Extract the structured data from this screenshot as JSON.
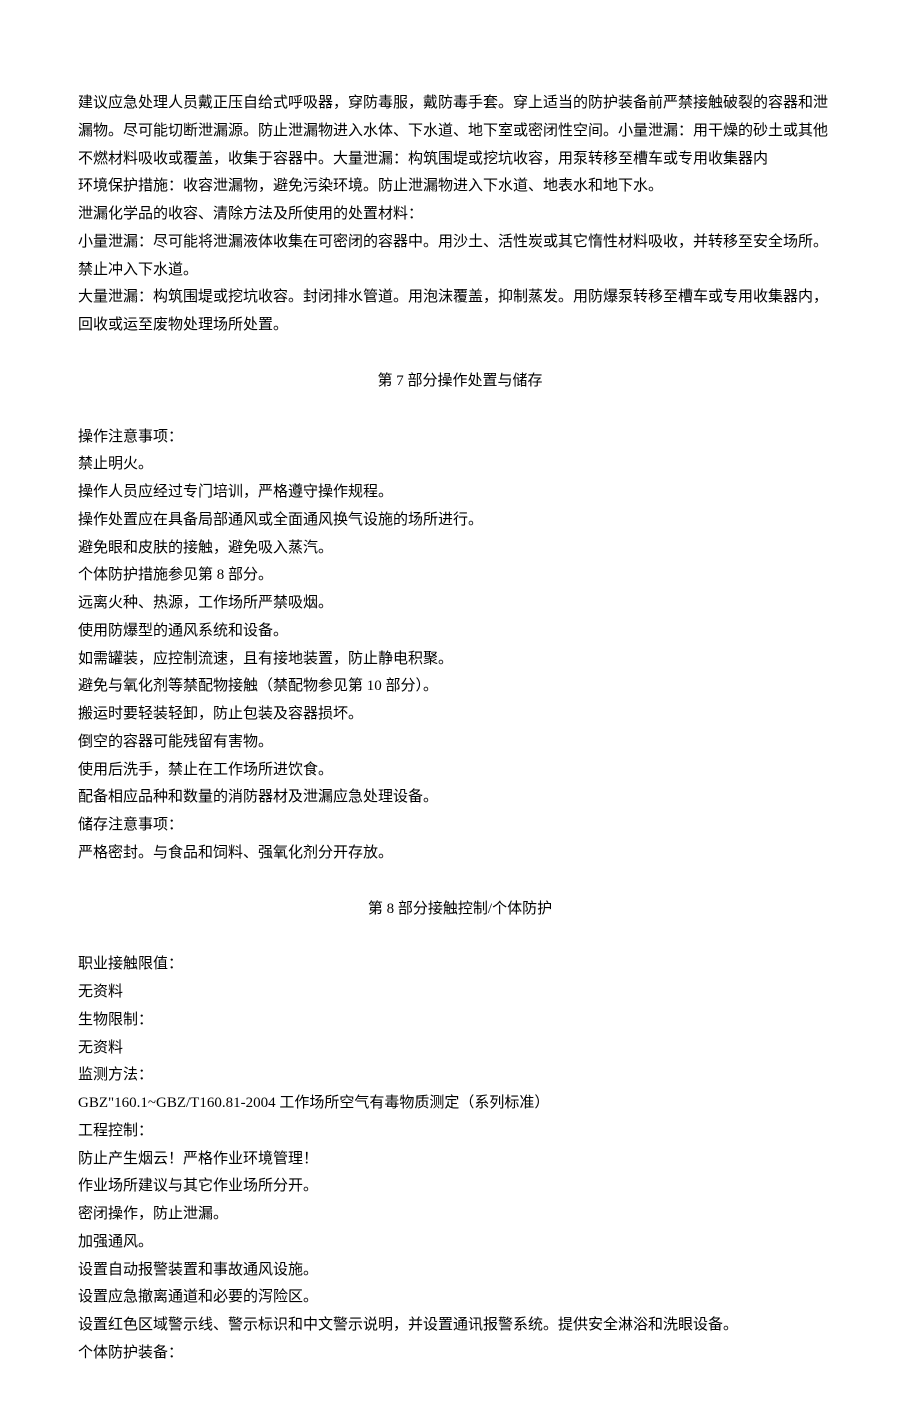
{
  "intro": {
    "p1": "建议应急处理人员戴正压自给式呼吸器，穿防毒服，戴防毒手套。穿上适当的防护装备前严禁接触破裂的容器和泄漏物。尽可能切断泄漏源。防止泄漏物进入水体、下水道、地下室或密闭性空间。小量泄漏：用干燥的砂土或其他不燃材料吸收或覆盖，收集于容器中。大量泄漏：构筑围堤或挖坑收容，用泵转移至槽车或专用收集器内",
    "p2": "环境保护措施：收容泄漏物，避免污染环境。防止泄漏物进入下水道、地表水和地下水。",
    "p3": "泄漏化学品的收容、清除方法及所使用的处置材料：",
    "p4": "小量泄漏：尽可能将泄漏液体收集在可密闭的容器中。用沙土、活性炭或其它惰性材料吸收，并转移至安全场所。禁止冲入下水道。",
    "p5": "大量泄漏：构筑围堤或挖坑收容。封闭排水管道。用泡沫覆盖，抑制蒸发。用防爆泵转移至槽车或专用收集器内，回收或运至废物处理场所处置。"
  },
  "section7": {
    "title": "第 7 部分操作处置与储存",
    "lines": [
      "操作注意事项：",
      "禁止明火。",
      "操作人员应经过专门培训，严格遵守操作规程。",
      "操作处置应在具备局部通风或全面通风换气设施的场所进行。",
      "避免眼和皮肤的接触，避免吸入蒸汽。",
      "个体防护措施参见第 8 部分。",
      "远离火种、热源，工作场所严禁吸烟。",
      "使用防爆型的通风系统和设备。",
      "如需罐装，应控制流速，且有接地装置，防止静电积聚。",
      "避免与氧化剂等禁配物接触（禁配物参见第 10 部分）。",
      "搬运时要轻装轻卸，防止包装及容器损坏。",
      "倒空的容器可能残留有害物。",
      "使用后洗手，禁止在工作场所进饮食。",
      "配备相应品种和数量的消防器材及泄漏应急处理设备。",
      "储存注意事项：",
      "严格密封。与食品和饲料、强氧化剂分开存放。"
    ]
  },
  "section8": {
    "title": "第 8 部分接触控制/个体防护",
    "lines": [
      "职业接触限值：",
      "无资料",
      "生物限制：",
      "无资料",
      "监测方法：",
      "GBZ\"160.1~GBZ/T160.81-2004 工作场所空气有毒物质测定（系列标准）",
      "工程控制：",
      "防止产生烟云！严格作业环境管理！",
      "作业场所建议与其它作业场所分开。",
      "密闭操作，防止泄漏。",
      "加强通风。",
      "设置自动报警装置和事故通风设施。",
      "设置应急撤离通道和必要的泻险区。",
      "设置红色区域警示线、警示标识和中文警示说明，并设置通讯报警系统。提供安全淋浴和洗眼设备。",
      "个体防护装备："
    ]
  }
}
